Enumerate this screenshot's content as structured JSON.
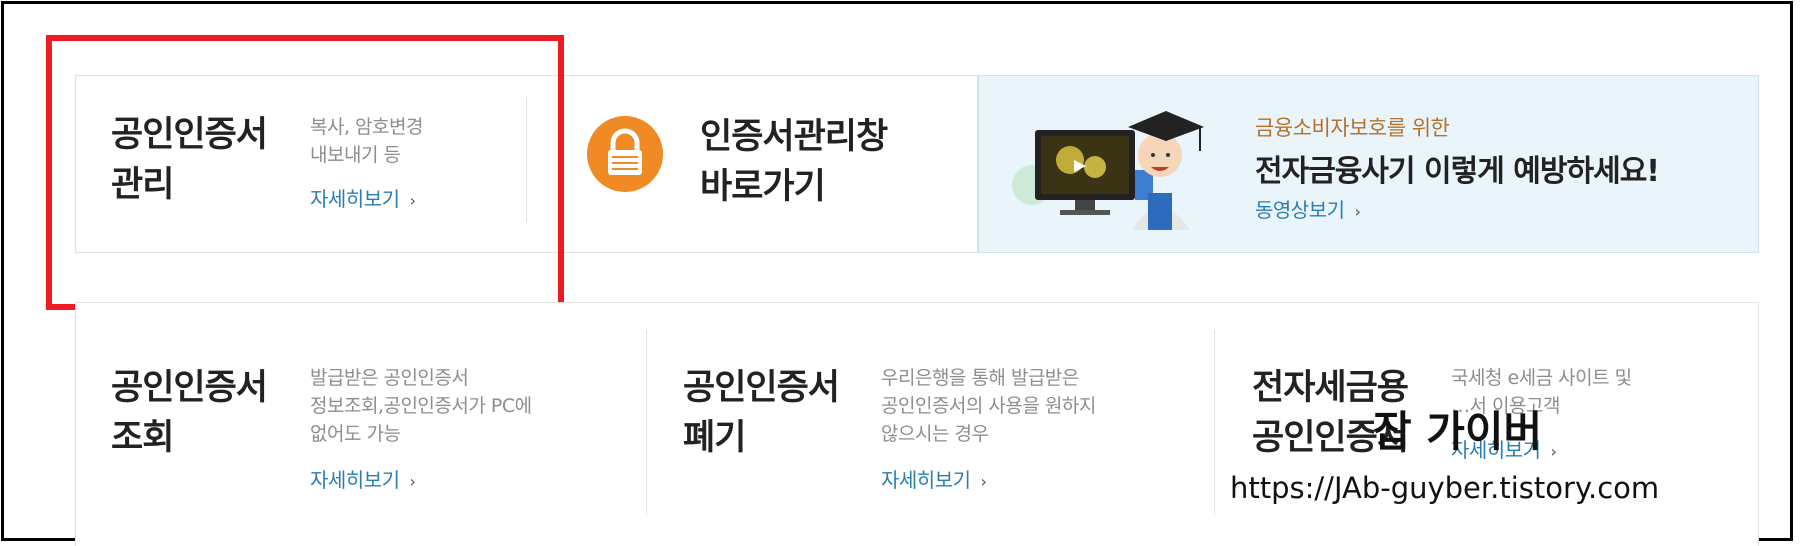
{
  "top_row": {
    "cert_manage": {
      "title": "공인인증서\n관리",
      "desc": "복사, 암호변경\n내보내기 등",
      "link": "자세히보기"
    },
    "cert_window": {
      "title": "인증서관리창\n바로가기"
    },
    "promo": {
      "eyebrow": "금융소비자보호를 위한",
      "headline": "전자금융사기 이렇게 예방하세요!",
      "link": "동영상보기"
    }
  },
  "bottom_row": [
    {
      "title": "공인인증서\n조회",
      "desc": "발급받은 공인인증서\n정보조회,공인인증서가 PC에\n없어도 가능",
      "link": "자세히보기"
    },
    {
      "title": "공인인증서\n폐기",
      "desc": "우리은행을 통해 발급받은\n공인인증서의 사용을 원하지\n않으시는 경우",
      "link": "자세히보기"
    },
    {
      "title": "전자세금용\n공인인증서",
      "desc": "국세청 e세금 사이트 및\n…서 이용고객",
      "link": "자세히보기"
    }
  ],
  "chevron": "›",
  "watermark": {
    "name": "잡 가이버",
    "url": "https://JAb-guyber.tistory.com"
  },
  "colors": {
    "highlight_box": "#ee1b24",
    "link": "#2a7fb0",
    "lock_icon": "#f08a24",
    "promo_bg": "#e9f5fb"
  },
  "icons": [
    "lock-icon",
    "graduate-tutor-illustration"
  ]
}
